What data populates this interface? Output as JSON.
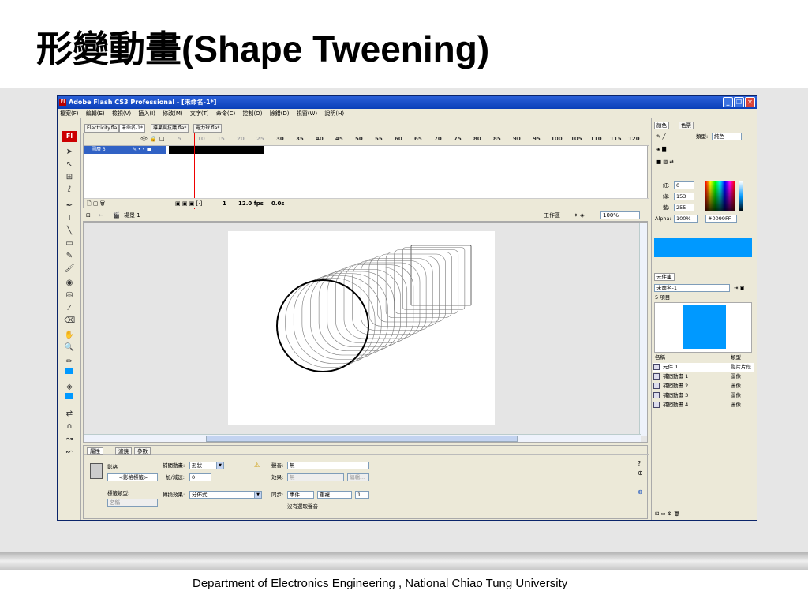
{
  "slide": {
    "title": "形變動畫(Shape Tweening)",
    "footer": "Department of Electronics Engineering , National Chiao Tung University"
  },
  "window": {
    "title": "Adobe Flash CS3 Professional - [未命名-1*]",
    "app_icon": "Fl",
    "menu": [
      "檔案(F)",
      "編輯(E)",
      "檢視(V)",
      "插入(I)",
      "修改(M)",
      "文字(T)",
      "命令(C)",
      "控制(O)",
      "除錯(D)",
      "視窗(W)",
      "說明(H)"
    ]
  },
  "doc_tabs": [
    "Electricity.fla",
    "未命名-1*",
    "導果與抗議.fla*",
    "電力球.fla*"
  ],
  "timeline": {
    "layer_name": "圖層 3",
    "frame_numbers": [
      "5",
      "10",
      "15",
      "20",
      "25",
      "30",
      "35",
      "40",
      "45",
      "50",
      "55",
      "60",
      "65",
      "70",
      "75",
      "80",
      "85",
      "90",
      "95",
      "100",
      "105",
      "110",
      "115",
      "120"
    ],
    "current_frame": "1",
    "fps": "12.0 fps",
    "time": "0.0s"
  },
  "scene": {
    "label": "場景 1",
    "workspace": "工作區",
    "zoom": "100%"
  },
  "properties": {
    "tabs": [
      "屬性",
      "濾鏡",
      "參數"
    ],
    "symbol_type": "影格",
    "frame_label_placeholder": "<影格標籤>",
    "tween_label": "補間動畫:",
    "tween_value": "形狀",
    "ease_label": "加/減速:",
    "ease_value": "0",
    "label_type_label": "標籤類型:",
    "label_type_value": "名稱",
    "blend_label": "轉換效果:",
    "blend_value": "分佈式",
    "sound_label": "聲音:",
    "sound_value": "無",
    "effect_label": "效果:",
    "effect_value": "無",
    "edit_button": "編輯...",
    "sync_label": "同步:",
    "sync_value": "事件",
    "repeat_value": "重複",
    "repeat_count": "1",
    "no_sound": "沒有選取聲音"
  },
  "color_panel": {
    "tabs": [
      "顏色",
      "色票"
    ],
    "type_label": "類型:",
    "type_value": "純色",
    "red_label": "紅:",
    "red_value": "0",
    "green_label": "綠:",
    "green_value": "153",
    "blue_label": "藍:",
    "blue_value": "255",
    "alpha_label": "Alpha:",
    "alpha_value": "100%",
    "hex_value": "#0099FF",
    "color": "#0099FF"
  },
  "library": {
    "tab": "元件庫",
    "document": "未命名-1",
    "count": "5 項目",
    "col_name": "名稱",
    "col_type": "類型",
    "items": [
      {
        "name": "元件 1",
        "kind": "影片片段"
      },
      {
        "name": "補間動畫 1",
        "kind": "圖像"
      },
      {
        "name": "補間動畫 2",
        "kind": "圖像"
      },
      {
        "name": "補間動畫 3",
        "kind": "圖像"
      },
      {
        "name": "補間動畫 4",
        "kind": "圖像"
      }
    ]
  }
}
